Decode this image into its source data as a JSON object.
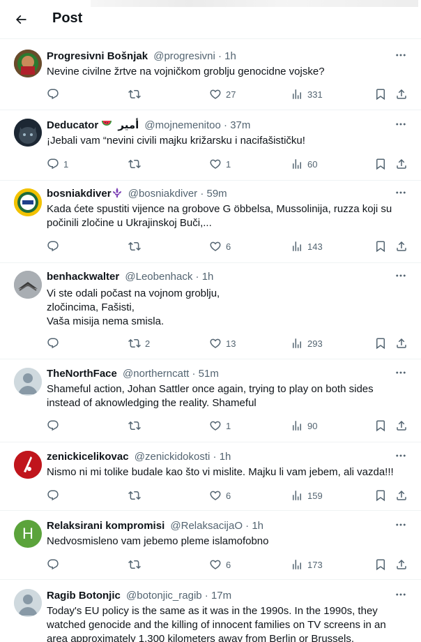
{
  "header": {
    "title": "Post"
  },
  "tweets": [
    {
      "name": "Progresivni Bošnjak",
      "handle": "@progresivni",
      "time": "1h",
      "text": "Nevine civilne žrtve na vojničkom groblju genocidne vojske?",
      "replies": "",
      "reposts": "",
      "likes": "27",
      "views": "331",
      "avatar_color": "#3a2d22"
    },
    {
      "name": "Deducator",
      "name_suffix": "أمير",
      "handle": "@mojnemenitoo",
      "time": "37m",
      "text": "¡Jebali vam “nevini civili majku križarsku i nacifašističku!",
      "replies": "1",
      "reposts": "",
      "likes": "1",
      "views": "60",
      "avatar_color": "#2a3440"
    },
    {
      "name": "bosniakdiver",
      "handle": "@bosniakdiver",
      "time": "59m",
      "text": "Kada ćete spustiti vijence na grobove G öbbelsa, Mussolinija,  ruzza koji su počinili zločine u Ukrajinskoj Buči,...",
      "replies": "",
      "reposts": "",
      "likes": "6",
      "views": "143",
      "avatar_color": "#f2c200"
    },
    {
      "name": "benhackwalter",
      "handle": "@Leobenhack",
      "time": "1h",
      "text": "Vi ste odali počast na vojnom groblju,\nzločincima, Fašisti,\nVaša misija nema smisla.",
      "replies": "",
      "reposts": "2",
      "likes": "13",
      "views": "293",
      "avatar_color": "#8a8f98"
    },
    {
      "name": "TheNorthFace",
      "handle": "@northerncatt",
      "time": "51m",
      "text": "Shameful action, Johan Sattler once again, trying to play on both sides instead of aknowledging the reality. Shameful",
      "replies": "",
      "reposts": "",
      "likes": "1",
      "views": "90",
      "avatar_color": "#cfd9de"
    },
    {
      "name": "zenickicelikovac",
      "handle": "@zenickidokosti",
      "time": "1h",
      "text": "Nismo ni mi tolike budale kao što vi mislite. Majku li vam jebem, ali vazda!!!",
      "replies": "",
      "reposts": "",
      "likes": "6",
      "views": "159",
      "avatar_color": "#c0151c"
    },
    {
      "name": "Relaksirani kompromisi",
      "handle": "@RelaksacijaO",
      "time": "1h",
      "text": "Nedvosmisleno vam jebemo pleme islamofobno",
      "replies": "",
      "reposts": "",
      "likes": "6",
      "views": "173",
      "avatar_color": "#5ba33b",
      "avatar_letter": "H"
    },
    {
      "name": "Ragib Botonjic",
      "handle": "@botonjic_ragib",
      "time": "17m",
      "text": "Today's EU policy is the same as it was in the 1990s. In the 1990s, they watched genocide and the killing of innocent families on TV screens in an area approximately 1,300 kilometers away from Berlin or Brussels.",
      "replies": "",
      "reposts": "",
      "likes": "",
      "views": "",
      "avatar_color": "#cfd9de"
    }
  ]
}
